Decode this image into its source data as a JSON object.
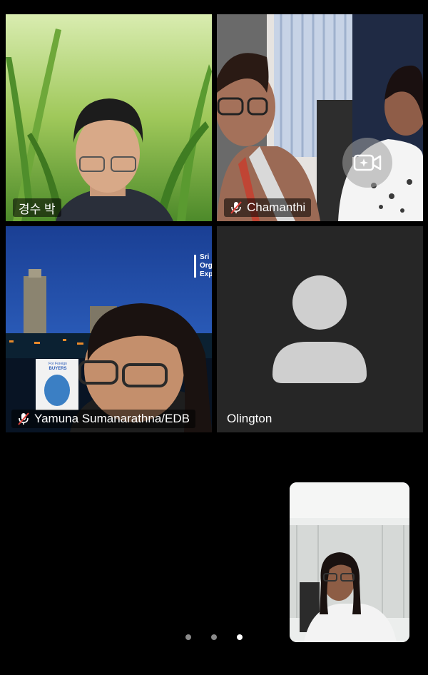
{
  "participants": [
    {
      "name": "경수 박",
      "muted": false,
      "active_speaker": true,
      "video": true
    },
    {
      "name": "Chamanthi",
      "muted": true,
      "active_speaker": false,
      "video": true
    },
    {
      "name": "Yamuna Sumanarathna/EDB",
      "muted": true,
      "active_speaker": false,
      "video": true
    },
    {
      "name": "Olington",
      "muted": false,
      "active_speaker": false,
      "video": false
    }
  ],
  "self_view": {
    "video": true
  },
  "background_text": {
    "slide_lines": [
      "Sri",
      "Org",
      "Exp"
    ],
    "book_title_small": "For Foreign",
    "book_title": "BUYERS"
  },
  "pager": {
    "total": 3,
    "current": 3
  },
  "colors": {
    "active_border": "#5fd44a",
    "tile_bg": "#262626",
    "muted_mic": "#e0403a"
  },
  "icons": {
    "camera_effects": "camera-sparkle-icon",
    "muted_mic": "mic-off-icon",
    "avatar": "person-avatar-icon"
  }
}
